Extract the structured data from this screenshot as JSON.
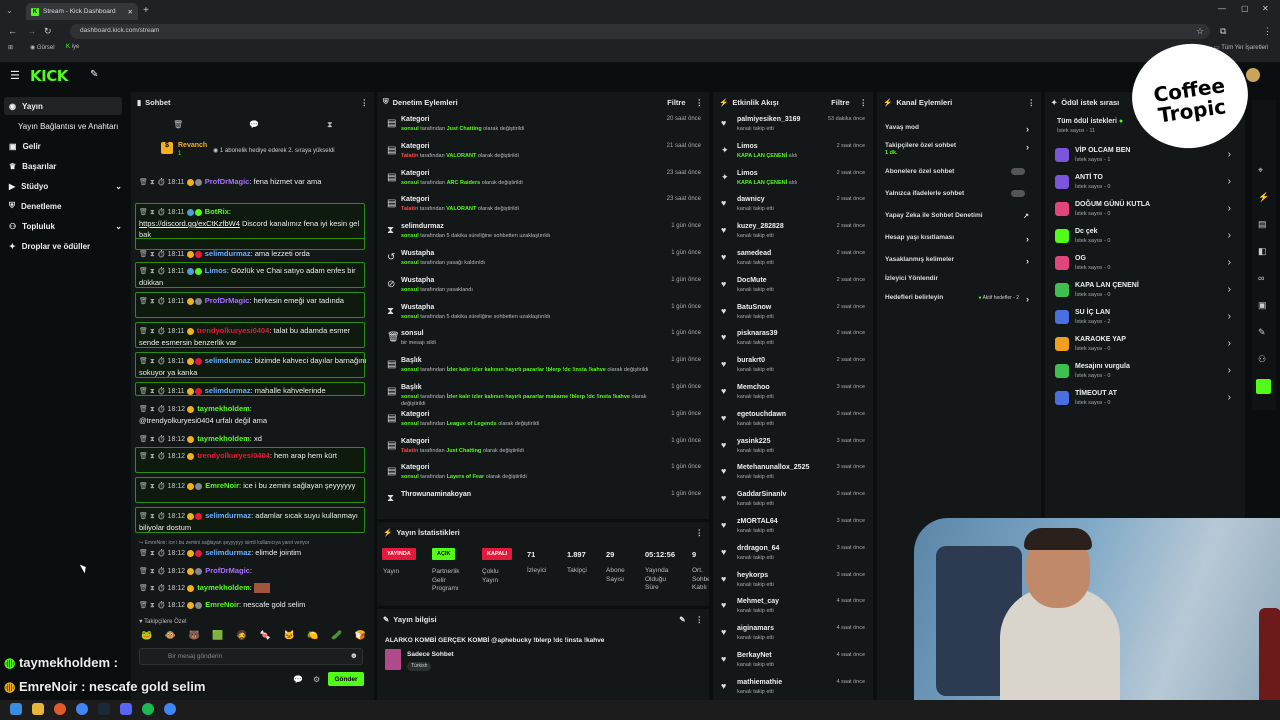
{
  "browser": {
    "tab_title": "Stream - Kick Dashboard",
    "url": "dashboard.kick.com/stream",
    "bookmarks": [
      "Görsel",
      "iye"
    ],
    "all_bookmarks": "Tüm Yer İşaretleri"
  },
  "colors": {
    "accent": "#53fc18",
    "panel": "#131718",
    "bg": "#0b0e0f",
    "danger": "#e21b3c"
  },
  "sidebar": {
    "items": [
      {
        "label": "Yayın",
        "icon": "broadcast-icon"
      },
      {
        "label": "Yayın Bağlantısı ve Anahtarı"
      },
      {
        "label": "Gelir",
        "icon": "wallet-icon"
      },
      {
        "label": "Başarılar",
        "icon": "trophy-icon"
      },
      {
        "label": "Stüdyo",
        "icon": "studio-icon"
      },
      {
        "label": "Denetleme",
        "icon": "shield-icon"
      },
      {
        "label": "Topluluk",
        "icon": "community-icon"
      },
      {
        "label": "Droplar ve ödüller",
        "icon": "gift-icon"
      }
    ]
  },
  "chat": {
    "title": "Sohbet",
    "pinned_user": "Revanch",
    "pinned_count": "1",
    "pinned_text": "1 abonelik hediye ederek 2. sıraya yükseldi",
    "messages": [
      {
        "time": "18:11",
        "user": "ProfDrMagic",
        "color": "#a970ff",
        "text": ": fena hizmet var ama"
      },
      {
        "time": "18:11",
        "user": "BotRix",
        "color": "#53fc18",
        "text": ":"
      },
      {
        "link": "https://discord.gg/exCtKzfbW4",
        "text": " Discord kanalımız fena iyi kesin gel bak"
      },
      {
        "time": "18:11",
        "user": "selimdurmaz",
        "color": "#6ab0ff",
        "text": ": ama lezzeti orda"
      },
      {
        "time": "18:11",
        "user": "Limos",
        "color": "#6ab0ff",
        "text": ": Gözlük ve Chai satıyo adam enfes bir dükkan"
      },
      {
        "time": "18:11",
        "user": "ProfDrMagic",
        "color": "#a970ff",
        "text": ": herkesin emeği var tadında"
      },
      {
        "time": "18:11",
        "user": "trendyolkuryesi0404",
        "color": "#e21b3c",
        "text": ": talat bu adamda esmer sende esmersin benzerlik var"
      },
      {
        "time": "18:11",
        "user": "selimdurmaz",
        "color": "#6ab0ff",
        "text": ": bizimde kahveci dayılar barnağını sokuyor ya kanka"
      },
      {
        "time": "18:11",
        "user": "selimdurmaz",
        "color": "#6ab0ff",
        "text": ": mahalle kahvelerinde"
      },
      {
        "time": "18:12",
        "user": "taymekholdem",
        "color": "#53fc18",
        "text": ":"
      },
      {
        "text": "@trendyolkuryesi0404 urfalı değil ama"
      },
      {
        "time": "18:12",
        "user": "taymekholdem",
        "color": "#53fc18",
        "text": ": xd"
      },
      {
        "time": "18:12",
        "user": "trendyolkuryesi0404",
        "color": "#e21b3c",
        "text": ": hem arap hem kürt"
      },
      {
        "time": "18:12",
        "user": "EmreNoir",
        "color": "#53fc18",
        "text": ": ice i bu zemini sağlayan şeyyyyyy"
      },
      {
        "time": "18:12",
        "user": "selimdurmaz",
        "color": "#6ab0ff",
        "text": ": adamlar sıcak suyu kullanmayı biliyolar dostum"
      },
      {
        "reply": "EmreNoir: ice i bu zemini sağlayan şeyyyyyy isimli kullanıcıya yanıt veriyor"
      },
      {
        "time": "18:12",
        "user": "selimdurmaz",
        "color": "#6ab0ff",
        "text": ": elimde jointim"
      },
      {
        "time": "18:12",
        "user": "ProfDrMagic",
        "color": "#a970ff",
        "text": ":"
      },
      {
        "time": "18:12",
        "user": "taymekholdem",
        "color": "#53fc18",
        "text": ":"
      },
      {
        "time": "18:12",
        "user": "EmreNoir",
        "color": "#53fc18",
        "text": ": nescafe gold selim"
      }
    ],
    "emote_label": "Takipçilere Özel",
    "input_placeholder": "Bir mesaj gönderin",
    "send": "Gönder"
  },
  "overlay": {
    "line1_user": "taymekholdem",
    "line1_text": " :",
    "line2_user": "EmreNoir",
    "line2_text": " : nescafe gold selim"
  },
  "modlog": {
    "title": "Denetim Eylemleri",
    "filter": "Filtre",
    "rows": [
      {
        "icon": "▤",
        "title": "Kategori",
        "user": "sonsul",
        "mid": " tarafından ",
        "val": "Just Chatting",
        "end": " olarak değiştirildi",
        "when": "20 saat önce"
      },
      {
        "icon": "▤",
        "title": "Kategori",
        "user": "Talatin",
        "mid": " tarafından ",
        "val": "VALORANT",
        "end": " olarak değiştirildi",
        "when": "21 saat önce"
      },
      {
        "icon": "▤",
        "title": "Kategori",
        "user": "sonsul",
        "mid": " tarafından ",
        "val": "ARC Raiders",
        "end": " olarak değiştirildi",
        "when": "23 saat önce"
      },
      {
        "icon": "▤",
        "title": "Kategori",
        "user": "Talatin",
        "mid": " tarafından ",
        "val": "VALORANT",
        "end": " olarak değiştirildi",
        "when": "23 saat önce"
      },
      {
        "icon": "⧗",
        "title": "selimdurmaz",
        "user": "sonsul",
        "mid": " tarafından 5 dakika süreliğine sohbetten uzaklaştırıldı",
        "val": "",
        "end": "",
        "when": "1 gün önce"
      },
      {
        "icon": "↺",
        "title": "Wustapha",
        "user": "sonsul",
        "mid": " tarafından yasağı kaldırıldı",
        "val": "",
        "end": "",
        "when": "1 gün önce"
      },
      {
        "icon": "⊘",
        "title": "Wustapha",
        "user": "sonsul",
        "mid": " tarafından yasaklandı",
        "val": "",
        "end": "",
        "when": "1 gün önce"
      },
      {
        "icon": "⧗",
        "title": "Wustapha",
        "user": "sonsul",
        "mid": " tarafından 5 dakika süreliğine sohbetten uzaklaştırıldı",
        "val": "",
        "end": "",
        "when": "1 gün önce"
      },
      {
        "icon": "🗑",
        "title": "sonsul",
        "user": "",
        "mid": "bir mesajı sildi",
        "val": "",
        "end": "",
        "when": "1 gün önce"
      },
      {
        "icon": "▤",
        "title": "Başlık",
        "user": "sonsul",
        "mid": " tarafından ",
        "val": "İzler kalır izler kalırsın hayırlı pazarlar !blerp !dc !insta !kahve",
        "end": " olarak değiştirildi",
        "when": "1 gün önce"
      },
      {
        "icon": "▤",
        "title": "Başlık",
        "user": "sonsul",
        "mid": " tarafından ",
        "val": "İzler kalır izler kalırsın hayırlı pazarlar makarne !blerp !dc !insta !kahve",
        "end": " olarak",
        "end2": "değiştirildi",
        "when": "1 gün önce"
      },
      {
        "icon": "▤",
        "title": "Kategori",
        "user": "sonsul",
        "mid": " tarafından ",
        "val": "League of Legends",
        "end": " olarak değiştirildi",
        "when": "1 gün önce"
      },
      {
        "icon": "▤",
        "title": "Kategori",
        "user": "Talatin",
        "mid": " tarafından ",
        "val": "Just Chatting",
        "end": " olarak değiştirildi",
        "when": "1 gün önce"
      },
      {
        "icon": "▤",
        "title": "Kategori",
        "user": "sonsul",
        "mid": " tarafından ",
        "val": "Layers of Fear",
        "end": " olarak değiştirildi",
        "when": "1 gün önce"
      },
      {
        "icon": "⧗",
        "title": "Throwunaminakoyan",
        "user": "",
        "mid": "",
        "val": "",
        "end": "",
        "when": "1 gün önce"
      }
    ]
  },
  "stats": {
    "title": "Yayın İstatistikleri",
    "badges": [
      {
        "text": "YAYINDA",
        "color": "#e21b3c",
        "label": "Yayın"
      },
      {
        "text": "AÇIK",
        "color": "#53fc18",
        "label": "Partnerlik Gelir Programı"
      },
      {
        "text": "KAPALI",
        "color": "#e21b3c",
        "label": "Çoklu Yayın"
      }
    ],
    "values": [
      {
        "v": "71",
        "l": "İzleyici"
      },
      {
        "v": "1.897",
        "l": "Takipçi"
      },
      {
        "v": "29",
        "l": "Abone Sayısı"
      },
      {
        "v": "05:12:56",
        "l": "Yayında Olduğu Süre"
      },
      {
        "v": "9",
        "l": "Ort. Sohbet Katılı"
      }
    ]
  },
  "info": {
    "title": "Yayın bilgisi",
    "stream_title": "ALARKO KOMBİ GERÇEK KOMBİ @aphebucky !blerp !dc !insta !kahve",
    "category": "Sadece Sohbet",
    "tag": "Türkish"
  },
  "activity": {
    "title": "Etkinlik Akışı",
    "filter": "Filtre",
    "events": [
      {
        "icon": "heart",
        "n": "palmiyesiken_3169",
        "s": "kanalı takip etti",
        "w": "53 dakika önce"
      },
      {
        "icon": "star",
        "n": "Limos",
        "s": "KAPA LAN ÇENENİ",
        "s2": " aldı",
        "w": "2 saat önce"
      },
      {
        "icon": "star",
        "n": "Limos",
        "s": "KAPA LAN ÇENENİ",
        "s2": " aldı",
        "w": "2 saat önce"
      },
      {
        "icon": "heart",
        "n": "dawnicy",
        "s": "kanalı takip etti",
        "w": "2 saat önce"
      },
      {
        "icon": "heart",
        "n": "kuzey_282828",
        "s": "kanalı takip etti",
        "w": "2 saat önce"
      },
      {
        "icon": "heart",
        "n": "samedead",
        "s": "kanalı takip etti",
        "w": "2 saat önce"
      },
      {
        "icon": "heart",
        "n": "DocMute",
        "s": "kanalı takip etti",
        "w": "2 saat önce"
      },
      {
        "icon": "heart",
        "n": "BatuSnow",
        "s": "kanalı takip etti",
        "w": "2 saat önce"
      },
      {
        "icon": "heart",
        "n": "pisknaras39",
        "s": "kanalı takip etti",
        "w": "2 saat önce"
      },
      {
        "icon": "heart",
        "n": "burakrt0",
        "s": "kanalı takip etti",
        "w": "2 saat önce"
      },
      {
        "icon": "heart",
        "n": "Memchoo",
        "s": "kanalı takip etti",
        "w": "3 saat önce"
      },
      {
        "icon": "heart",
        "n": "egetouchdawn",
        "s": "kanalı takip etti",
        "w": "3 saat önce"
      },
      {
        "icon": "heart",
        "n": "yasink225",
        "s": "kanalı takip etti",
        "w": "3 saat önce"
      },
      {
        "icon": "heart",
        "n": "Metehanunallox_2525",
        "s": "kanalı takip etti",
        "w": "3 saat önce"
      },
      {
        "icon": "heart",
        "n": "GaddarSinanlv",
        "s": "kanalı takip etti",
        "w": "3 saat önce"
      },
      {
        "icon": "heart",
        "n": "zMORTAL64",
        "s": "kanalı takip etti",
        "w": "3 saat önce"
      },
      {
        "icon": "heart",
        "n": "drdragon_64",
        "s": "kanalı takip etti",
        "w": "3 saat önce"
      },
      {
        "icon": "heart",
        "n": "heykorps",
        "s": "kanalı takip etti",
        "w": "3 saat önce"
      },
      {
        "icon": "heart",
        "n": "Mehmet_cay",
        "s": "kanalı takip etti",
        "w": "4 saat önce"
      },
      {
        "icon": "heart",
        "n": "aiginamars",
        "s": "kanalı takip etti",
        "w": "4 saat önce"
      },
      {
        "icon": "heart",
        "n": "BerkayNet",
        "s": "kanalı takip etti",
        "w": "4 saat önce"
      },
      {
        "icon": "heart",
        "n": "mathiemathie",
        "s": "kanalı takip etti",
        "w": "4 saat önce"
      }
    ]
  },
  "channel": {
    "title": "Kanal Eylemleri",
    "items": [
      {
        "label": "Yavaş mod",
        "kind": "arrow"
      },
      {
        "label": "Takipçilere özel sohbet",
        "sub": "1 dk.",
        "kind": "arrow"
      },
      {
        "label": "Abonelere özel sohbet",
        "kind": "toggle"
      },
      {
        "label": "Yalnızca ifadelerle sohbet",
        "kind": "toggle"
      },
      {
        "label": "Yapay Zeka ile Sohbet Denetimi",
        "kind": "link"
      },
      {
        "label": "Hesap yaşı kısıtlaması",
        "kind": "arrow"
      },
      {
        "label": "Yasaklanmış kelimeler",
        "kind": "arrow"
      },
      {
        "label": "İzleyici Yönlendir",
        "kind": "none"
      },
      {
        "label": "Hedefleri belirleyin",
        "kind": "goal",
        "extra": "Aktif hedefler - 2"
      }
    ]
  },
  "rewards": {
    "title": "Ödül istek sırası",
    "all": "Tüm ödül istekleri",
    "all_sub": "İstek sayısı - 11",
    "items": [
      {
        "t": "VİP OLCAM BEN",
        "s": "İstek sayısı - 1",
        "c": "#7b55d9"
      },
      {
        "t": "ANTİ TO",
        "s": "İstek sayısı - 0",
        "c": "#7b55d9"
      },
      {
        "t": "DOĞUM GÜNÜ KUTLA",
        "s": "İstek sayısı - 0",
        "c": "#e0457b"
      },
      {
        "t": "Dc çek",
        "s": "İstek sayısı - 0",
        "c": "#53fc18"
      },
      {
        "t": "OG",
        "s": "İstek sayısı - 0",
        "c": "#e0457b"
      },
      {
        "t": "KAPA LAN ÇENENİ",
        "s": "İstek sayısı - 0",
        "c": "#3fbf4f"
      },
      {
        "t": "SU İÇ LAN",
        "s": "İstek sayısı - 2",
        "c": "#4a6fe0"
      },
      {
        "t": "KARAOKE YAP",
        "s": "İstek sayısı - 0",
        "c": "#f0a020"
      },
      {
        "t": "Mesajını vurgula",
        "s": "İstek sayısı - 0",
        "c": "#3fbf4f"
      },
      {
        "t": "TİMEOUT AT",
        "s": "İstek sayısı - 0",
        "c": "#4a6fe0"
      }
    ]
  },
  "brand": {
    "kick": "KICK",
    "overlay_line1": "Coffee",
    "overlay_line2": "Tropic"
  }
}
